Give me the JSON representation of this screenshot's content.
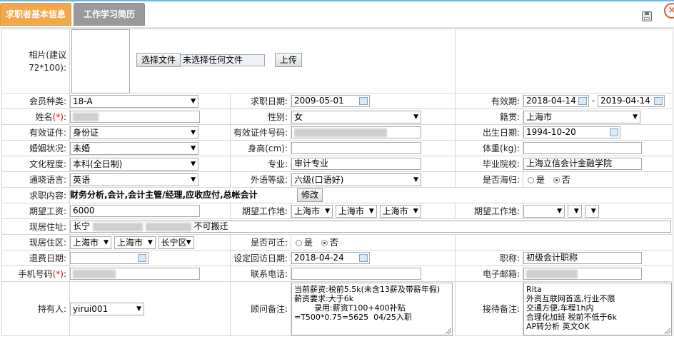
{
  "tabs": [
    {
      "label": "求职者基本信息",
      "active": true
    },
    {
      "label": "工作学习简历",
      "active": false
    }
  ],
  "colors": {
    "active_tab": "#f0a94a",
    "inactive_tab": "#9a9a9a",
    "required": "#dd0000",
    "border": "#d6d6d6"
  },
  "photo": {
    "label": "相片(建议72*100):",
    "choose_button": "选择文件",
    "file_status": "未选择任何文件",
    "upload_button": "上传"
  },
  "fields": {
    "member_type": {
      "label": "会员种类:",
      "value": "18-A"
    },
    "apply_date": {
      "label": "求职日期:",
      "value": "2009-05-01"
    },
    "valid_period": {
      "label": "有效期:",
      "from": "2018-04-14",
      "sep": "-",
      "to": "2019-04-14"
    },
    "name": {
      "label": "姓名",
      "req": "(*)",
      "colon": ":",
      "value": ""
    },
    "gender": {
      "label": "性别:",
      "value": "女"
    },
    "native_place": {
      "label": "籍贯:",
      "value": "上海市"
    },
    "id_type": {
      "label": "有效证件:",
      "value": "身份证"
    },
    "id_number": {
      "label": "有效证件号码:",
      "value": ""
    },
    "birth_date": {
      "label": "出生日期:",
      "value": "1994-10-20"
    },
    "marital": {
      "label": "婚姻状况:",
      "value": "未婚"
    },
    "height": {
      "label": "身高(cm):",
      "value": ""
    },
    "weight": {
      "label": "体重(kg):",
      "value": ""
    },
    "education": {
      "label": "文化程度:",
      "value": "本科(全日制)"
    },
    "major": {
      "label": "专业:",
      "value": "审计专业"
    },
    "school": {
      "label": "毕业院校:",
      "value": "上海立信会计金融学院"
    },
    "language": {
      "label": "通晓语言:",
      "value": "英语"
    },
    "lang_level": {
      "label": "外语等级:",
      "value": "六级(口语好)"
    },
    "returnee": {
      "label": "是否海归:",
      "opt_yes": "是",
      "opt_no": "否",
      "selected": "否"
    },
    "job_content": {
      "label": "求职内容:",
      "value": "财务分析,会计,会计主管/经理,应收应付,总帐会计",
      "edit_button": "修改"
    },
    "salary": {
      "label": "期望工资:",
      "value": "6000"
    },
    "work_place": {
      "label": "期望工作地:",
      "province": "上海市",
      "city": "上海市",
      "district": "上海市"
    },
    "work_place2": {
      "label": "期望工作地:",
      "province": "",
      "city": "",
      "district": ""
    },
    "address": {
      "label": "现居住址:",
      "prefix": "长宁",
      "suffix": "不可搬迁"
    },
    "living_area": {
      "label": "现居住区:",
      "province": "上海市",
      "city": "上海市",
      "district": "长宁区"
    },
    "relocate": {
      "label": "是否可迁:",
      "opt_yes": "是",
      "opt_no": "否",
      "selected": "否"
    },
    "refund_date": {
      "label": "退费日期:",
      "value": ""
    },
    "revisit_date": {
      "label": "设定回访日期:",
      "value": "2018-04-24"
    },
    "title": {
      "label": "职称:",
      "value": "初级会计职称"
    },
    "mobile": {
      "label": "手机号码",
      "req": "(*)",
      "colon": ":",
      "value": ""
    },
    "phone": {
      "label": "联系电话:",
      "value": ""
    },
    "email": {
      "label": "电子邮箱:",
      "value": ""
    },
    "holder": {
      "label": "持有人:",
      "value": "yirui001"
    },
    "consultant_note": {
      "label": "顾问备注:",
      "value": "当前薪资:税前5.5k(未含13薪及带薪年假)\n薪资要求:大于6k\n        录用:薪资T100+400补贴\n=T500*0.75=5625  04/25入职"
    },
    "reception_note": {
      "label": "接待备注:",
      "value": "Rita\n外资互联网首选,行业不限\n交通方便,车程1h内\n合理化加班 税前不低于6k\nAP转分析 英文OK"
    }
  }
}
